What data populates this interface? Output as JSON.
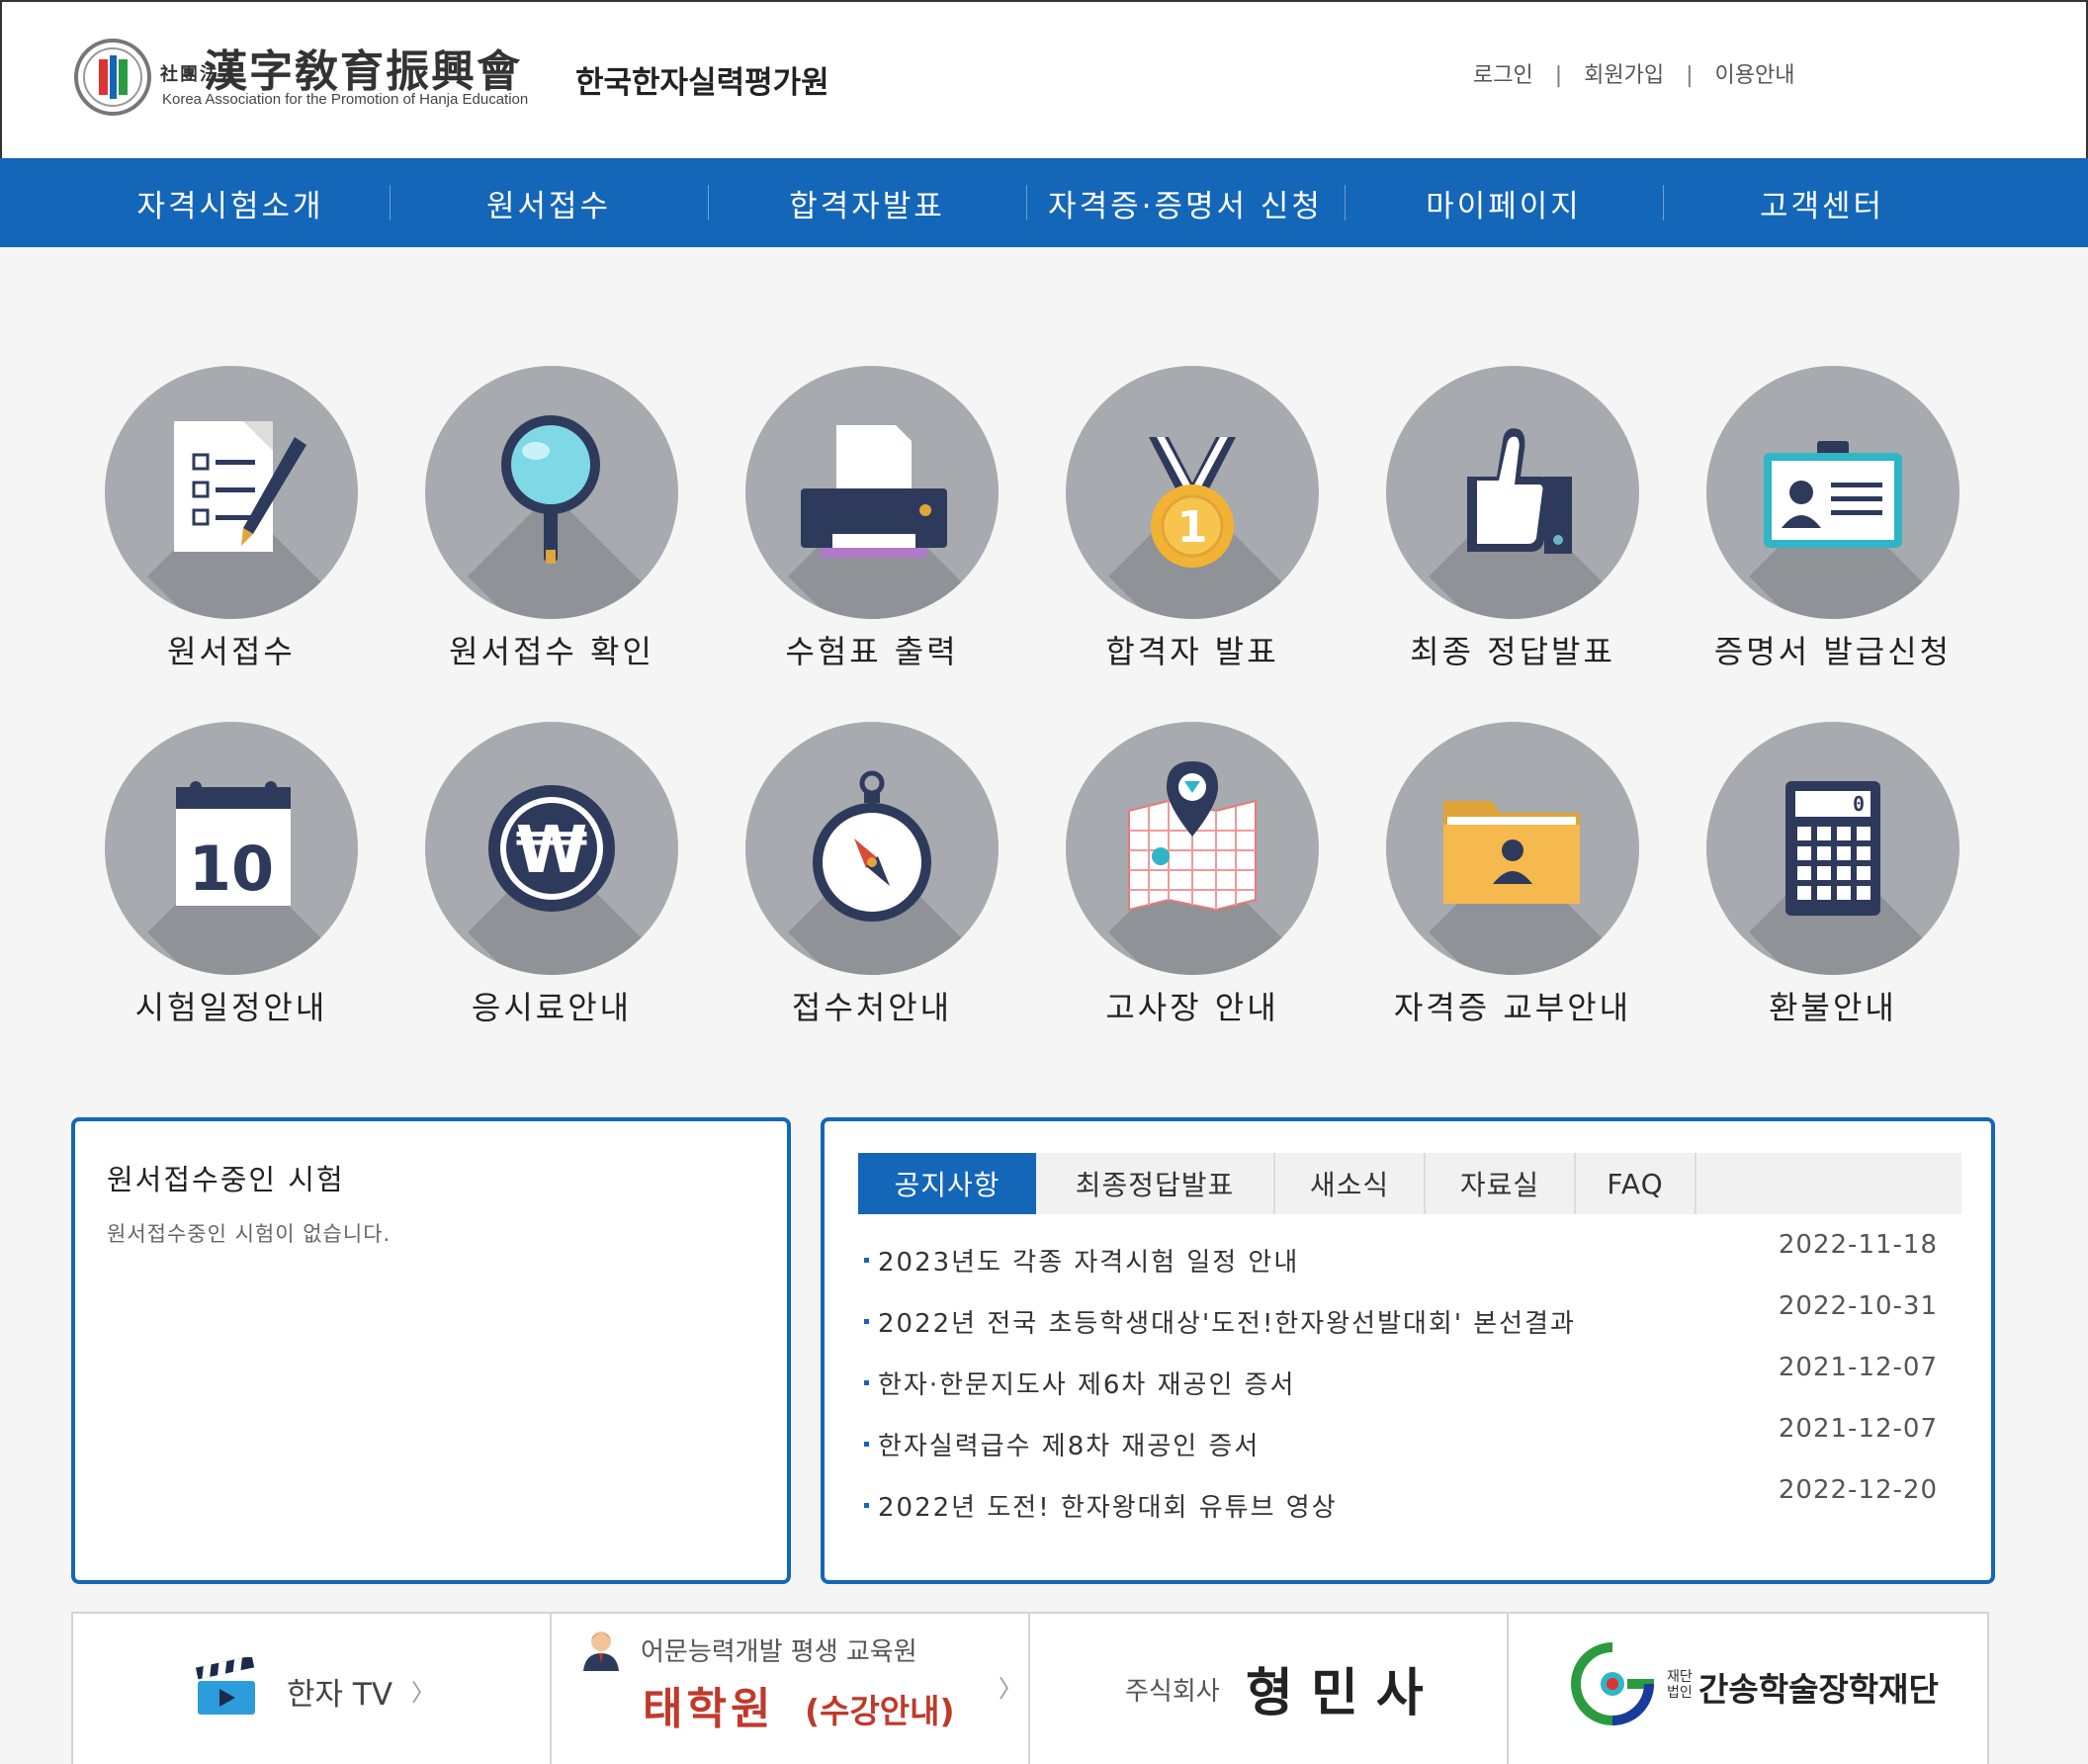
{
  "header": {
    "org_hanja_small": "社團法人",
    "org_hanja": "漢字敎育振興會",
    "org_english": "Korea Association for the Promotion of Hanja Education",
    "org_korean": "한국한자실력평가원",
    "util_links": [
      "로그인",
      "회원가입",
      "이용안내"
    ]
  },
  "nav": {
    "items": [
      "자격시험소개",
      "원서접수",
      "합격자발표",
      "자격증·증명서 신청",
      "마이페이지",
      "고객센터"
    ]
  },
  "quick_menu": {
    "row1": [
      {
        "label": "원서접수",
        "icon": "application-form-icon"
      },
      {
        "label": "원서접수 확인",
        "icon": "magnifier-icon"
      },
      {
        "label": "수험표 출력",
        "icon": "printer-icon"
      },
      {
        "label": "합격자 발표",
        "icon": "medal-icon"
      },
      {
        "label": "최종 정답발표",
        "icon": "thumbs-up-icon"
      },
      {
        "label": "증명서 발급신청",
        "icon": "id-card-icon"
      }
    ],
    "row2": [
      {
        "label": "시험일정안내",
        "icon": "calendar-icon",
        "calendar_number": "10"
      },
      {
        "label": "응시료안내",
        "icon": "won-coin-icon"
      },
      {
        "label": "접수처안내",
        "icon": "compass-icon"
      },
      {
        "label": "고사장 안내",
        "icon": "map-pin-icon"
      },
      {
        "label": "자격증 교부안내",
        "icon": "folder-person-icon"
      },
      {
        "label": "환불안내",
        "icon": "calculator-icon",
        "calculator_display": "0"
      }
    ]
  },
  "exam_box": {
    "title": "원서접수중인 시험",
    "empty_message": "원서접수중인 시험이 없습니다."
  },
  "notice_box": {
    "tabs": [
      "공지사항",
      "최종정답발표",
      "새소식",
      "자료실",
      "FAQ"
    ],
    "active_tab": 0,
    "items": [
      {
        "title": "2023년도 각종 자격시험 일정 안내",
        "date": "2022-11-18"
      },
      {
        "title": "2022년 전국 초등학생대상'도전!한자왕선발대회' 본선결과",
        "date": "2022-10-31"
      },
      {
        "title": "한자·한문지도사 제6차 재공인 증서",
        "date": "2021-12-07"
      },
      {
        "title": "한자실력급수 제8차 재공인 증서",
        "date": "2021-12-07"
      },
      {
        "title": "2022년 도전! 한자왕대회 유튜브 영상",
        "date": "2022-12-20"
      }
    ]
  },
  "banners": {
    "hanja_tv": {
      "label": "한자 TV",
      "arrow": "〉",
      "icon": "clapperboard-icon"
    },
    "taehakwon": {
      "line1": "어문능력개발 평생 교육원",
      "name": "태학원",
      "sub": "(수강안내)",
      "arrow": "〉",
      "icon": "teacher-icon"
    },
    "hyeongminsa": {
      "prefix": "주식회사",
      "name": "형 민 사"
    },
    "gansong": {
      "prefix_top": "재단",
      "prefix_bottom": "법인",
      "name": "간송학술장학재단",
      "icon": "gansong-logo-icon"
    }
  },
  "colors": {
    "brand_blue": "#1466b8",
    "circle_gray": "#a7aaae",
    "taehakwon_red": "#c0392b"
  }
}
